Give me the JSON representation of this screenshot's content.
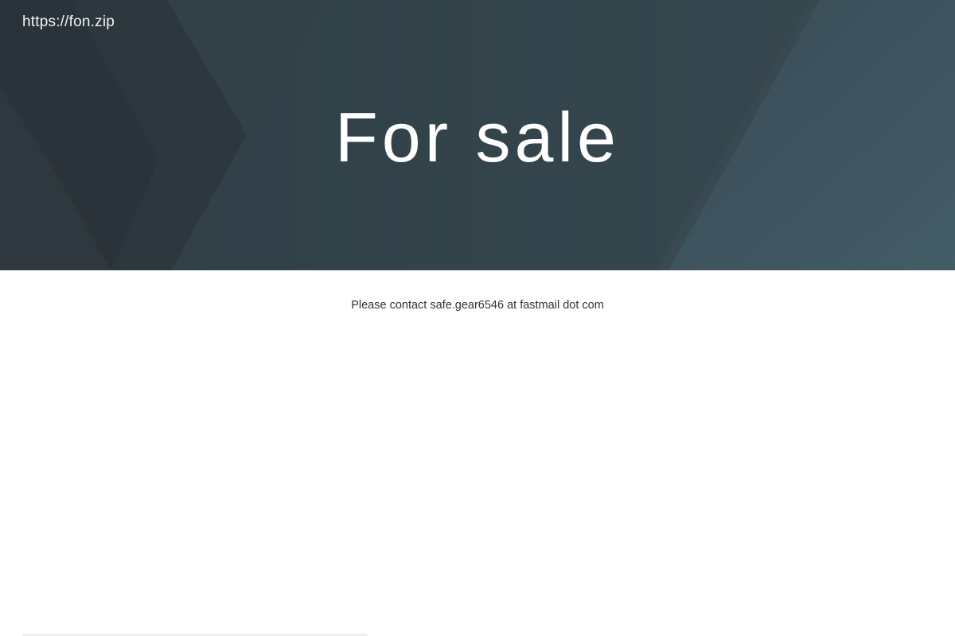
{
  "header": {
    "site_link": "https://fon.zip"
  },
  "hero": {
    "title": "For sale"
  },
  "main": {
    "contact_text": "Please contact safe.gear6546 at fastmail dot com"
  },
  "colors": {
    "hero_dark": "#2f3a41",
    "hero_mid": "#37464f",
    "hero_light": "#445863",
    "text_on_hero": "#ffffff",
    "body_text": "#333333",
    "page_background": "#ffffff"
  }
}
